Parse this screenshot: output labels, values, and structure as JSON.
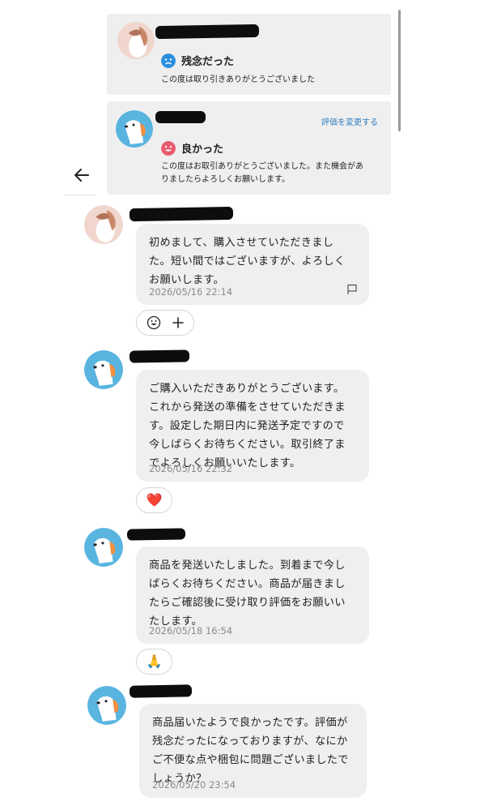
{
  "reviews": [
    {
      "rating_label": "残念だった",
      "comment": "この度は取り引きありがとうございました",
      "rating_color": "#2b8fe0"
    },
    {
      "rating_label": "良かった",
      "comment_line1": "この度はお取引ありがとうございました。また機会があ",
      "comment_line2": "りましたらよろしくお願いします。",
      "change_link": "評価を変更する",
      "rating_color": "#e95a6f"
    }
  ],
  "messages": [
    {
      "sender": "buyer",
      "text": "初めまして、購入させていただきました。短い間ではございますが、よろしくお願いします。",
      "lines": [
        "初めまして、購入させていただきまし",
        "た。短い間ではございますが、よろしく",
        "お願いします。"
      ],
      "time": "2026/05/16 22:14",
      "reactions": [
        "smiley-icon",
        "add-reaction-icon"
      ]
    },
    {
      "sender": "seller",
      "lines": [
        "ご購入いただきありがとうございます。",
        "これから発送の準備をさせていただきま",
        "す。設定した期日内に発送予定ですので",
        "今しばらくお待ちください。取引終了ま",
        "でよろしくお願いいたします。"
      ],
      "time": "2026/05/16 22:32",
      "reaction": "❤️"
    },
    {
      "sender": "seller",
      "lines": [
        "商品を発送いたしました。到着まで今し",
        "ばらくお待ちください。商品が届きまし",
        "たらご確認後に受け取り評価をお願いい",
        "たします。"
      ],
      "time": "2026/05/18 16:54",
      "reaction": "🙏"
    },
    {
      "sender": "seller",
      "lines": [
        "商品届いたようで良かったです。評価が",
        "残念だったになっておりますが、なにか",
        "ご不便な点や梱包に問題ございましたで",
        "しょうか？"
      ],
      "time": "2026/05/20 23:54"
    }
  ],
  "colors": {
    "bubble_bg": "#efefef",
    "link": "#2f7fc1",
    "timestamp": "#8a8a8a"
  }
}
